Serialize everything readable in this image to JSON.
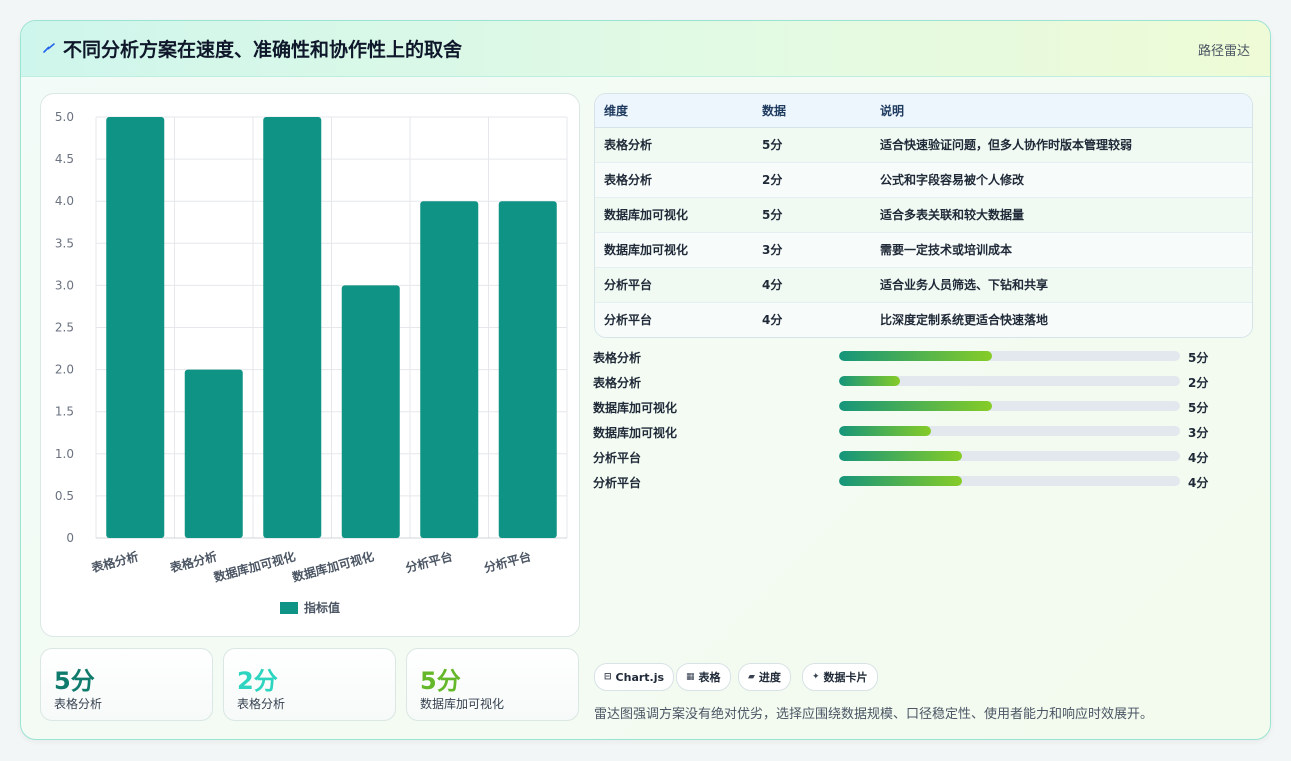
{
  "header": {
    "title": "不同分析方案在速度、准确性和协作性上的取舍",
    "tag": "路径雷达",
    "icon": "bolt-icon",
    "accent": "#2563eb"
  },
  "chart_data": {
    "type": "bar",
    "categories": [
      "表格分析",
      "表格分析",
      "数据库加可视化",
      "数据库加可视化",
      "分析平台",
      "分析平台"
    ],
    "series": [
      {
        "name": "指标值",
        "values": [
          5,
          2,
          5,
          3,
          4,
          4
        ],
        "color": "#0e9384"
      }
    ],
    "yticks": [
      "5.0",
      "4.5",
      "4.0",
      "3.5",
      "3.0",
      "2.5",
      "2.0",
      "1.5",
      "1.0",
      "0.5",
      "0"
    ],
    "ylim": [
      0,
      5
    ],
    "grid": true,
    "legend": "bottom"
  },
  "table": {
    "headers": [
      "维度",
      "数据",
      "说明"
    ],
    "rows": [
      [
        "表格分析",
        "5分",
        "适合快速验证问题，但多人协作时版本管理较弱"
      ],
      [
        "表格分析",
        "2分",
        "公式和字段容易被个人修改"
      ],
      [
        "数据库加可视化",
        "5分",
        "适合多表关联和较大数据量"
      ],
      [
        "数据库加可视化",
        "3分",
        "需要一定技术或培训成本"
      ],
      [
        "分析平台",
        "4分",
        "适合业务人员筛选、下钻和共享"
      ],
      [
        "分析平台",
        "4分",
        "比深度定制系统更适合快速落地"
      ]
    ]
  },
  "progress": [
    {
      "label": "表格分析",
      "value": "5分",
      "fraction": 0.45
    },
    {
      "label": "表格分析",
      "value": "2分",
      "fraction": 0.18
    },
    {
      "label": "数据库加可视化",
      "value": "5分",
      "fraction": 0.45
    },
    {
      "label": "数据库加可视化",
      "value": "3分",
      "fraction": 0.27
    },
    {
      "label": "分析平台",
      "value": "4分",
      "fraction": 0.36
    },
    {
      "label": "分析平台",
      "value": "4分",
      "fraction": 0.36
    }
  ],
  "stats": [
    {
      "value": "5分",
      "label": "表格分析",
      "color": "#0f7b6c"
    },
    {
      "value": "2分",
      "label": "表格分析",
      "color": "#2dd4bf"
    },
    {
      "value": "5分",
      "label": "数据库加可视化",
      "color": "#65b82a"
    }
  ],
  "pills": [
    {
      "icon": "⊟",
      "label": "Chart.js"
    },
    {
      "icon": "▦",
      "label": "表格"
    },
    {
      "icon": "▰",
      "label": "进度"
    },
    {
      "icon": "✦",
      "label": "数据卡片"
    }
  ],
  "footer": {
    "note": "雷达图强调方案没有绝对优劣，选择应围绕数据规模、口径稳定性、使用者能力和响应时效展开。"
  }
}
